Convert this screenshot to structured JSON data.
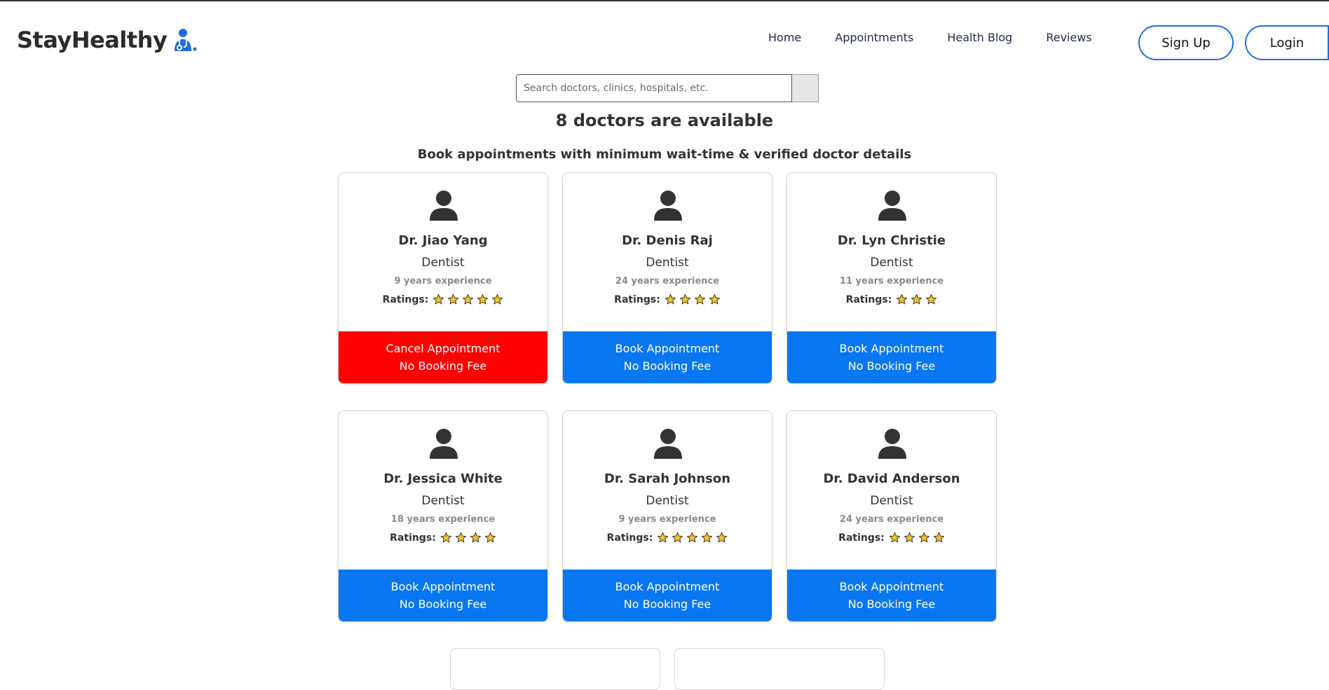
{
  "brand": {
    "name": "StayHealthy",
    "accent": "#1b6fe0"
  },
  "nav": {
    "items": [
      "Home",
      "Appointments",
      "Health Blog",
      "Reviews"
    ]
  },
  "auth": {
    "signup_label": "Sign Up",
    "login_label": "Login"
  },
  "search": {
    "placeholder": "Search doctors, clinics, hospitals, etc.",
    "value": ""
  },
  "headline": "8 doctors are available",
  "subheadline": "Book appointments with minimum wait-time & verified doctor details",
  "ratings_label": "Ratings:",
  "doctors": [
    {
      "name": "Dr. Jiao Yang",
      "specialty": "Dentist",
      "experience": "9 years experience",
      "rating": 5,
      "action": "Cancel Appointment",
      "fee": "No Booking Fee",
      "action_type": "cancel"
    },
    {
      "name": "Dr. Denis Raj",
      "specialty": "Dentist",
      "experience": "24 years experience",
      "rating": 4,
      "action": "Book Appointment",
      "fee": "No Booking Fee",
      "action_type": "book"
    },
    {
      "name": "Dr. Lyn Christie",
      "specialty": "Dentist",
      "experience": "11 years experience",
      "rating": 3,
      "action": "Book Appointment",
      "fee": "No Booking Fee",
      "action_type": "book"
    },
    {
      "name": "Dr. Jessica White",
      "specialty": "Dentist",
      "experience": "18 years experience",
      "rating": 4,
      "action": "Book Appointment",
      "fee": "No Booking Fee",
      "action_type": "book"
    },
    {
      "name": "Dr. Sarah Johnson",
      "specialty": "Dentist",
      "experience": "9 years experience",
      "rating": 5,
      "action": "Book Appointment",
      "fee": "No Booking Fee",
      "action_type": "book"
    },
    {
      "name": "Dr. David Anderson",
      "specialty": "Dentist",
      "experience": "24 years experience",
      "rating": 4,
      "action": "Book Appointment",
      "fee": "No Booking Fee",
      "action_type": "book"
    }
  ],
  "colors": {
    "book": "#0a77f2",
    "cancel": "#ff0000",
    "star": "#f5c518"
  }
}
